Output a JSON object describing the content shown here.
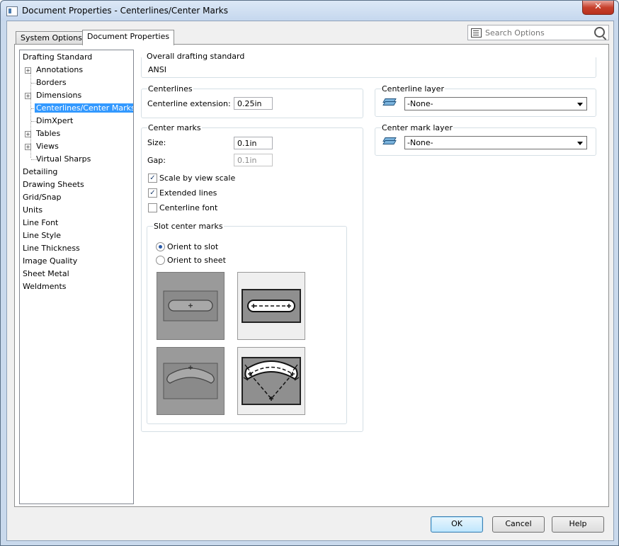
{
  "window": {
    "title": "Document Properties - Centerlines/Center Marks",
    "close_label": "✕"
  },
  "tabs": [
    {
      "label": "System Options",
      "active": false
    },
    {
      "label": "Document Properties",
      "active": true
    }
  ],
  "search": {
    "placeholder": "Search Options"
  },
  "tree": {
    "items": [
      {
        "label": "Drafting Standard"
      },
      {
        "label": "Annotations"
      },
      {
        "label": "Borders"
      },
      {
        "label": "Dimensions"
      },
      {
        "label": "Centerlines/Center Marks"
      },
      {
        "label": "DimXpert"
      },
      {
        "label": "Tables"
      },
      {
        "label": "Views"
      },
      {
        "label": "Virtual Sharps"
      },
      {
        "label": "Detailing"
      },
      {
        "label": "Drawing Sheets"
      },
      {
        "label": "Grid/Snap"
      },
      {
        "label": "Units"
      },
      {
        "label": "Line Font"
      },
      {
        "label": "Line Style"
      },
      {
        "label": "Line Thickness"
      },
      {
        "label": "Image Quality"
      },
      {
        "label": "Sheet Metal"
      },
      {
        "label": "Weldments"
      }
    ]
  },
  "overall": {
    "label": "Overall drafting standard",
    "value": "ANSI"
  },
  "centerlines": {
    "label": "Centerlines",
    "extension_label": "Centerline extension:",
    "extension_value": "0.25in"
  },
  "center_marks": {
    "label": "Center marks",
    "size_label": "Size:",
    "size_value": "0.1in",
    "gap_label": "Gap:",
    "gap_value": "0.1in",
    "scale_by_view_label": "Scale by view scale",
    "scale_by_view_checked": true,
    "extended_lines_label": "Extended lines",
    "extended_lines_checked": true,
    "centerline_font_label": "Centerline font",
    "centerline_font_checked": false
  },
  "slot_center_marks": {
    "label": "Slot center marks",
    "orient_to_slot_label": "Orient to slot",
    "orient_to_sheet_label": "Orient to sheet"
  },
  "centerline_layer": {
    "label": "Centerline layer",
    "value": "-None-"
  },
  "center_mark_layer": {
    "label": "Center mark layer",
    "value": "-None-"
  },
  "buttons": {
    "ok": "OK",
    "cancel": "Cancel",
    "help": "Help"
  },
  "icons": {
    "check": "✓",
    "expand": "+"
  }
}
